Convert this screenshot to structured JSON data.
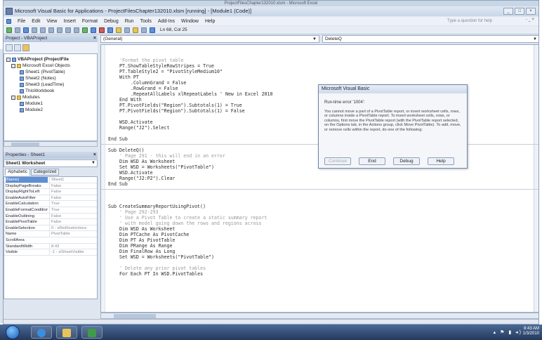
{
  "window": {
    "excel_title": "ProjectFilesChapter132010.xlsm - Microsoft Excel",
    "title": "Microsoft Visual Basic for Applications - ProjectFilesChapter132010.xlsm [running] - [Module1 (Code)]",
    "controls": [
      "_",
      "□",
      "×"
    ]
  },
  "menu": {
    "items": [
      "File",
      "Edit",
      "View",
      "Insert",
      "Format",
      "Debug",
      "Run",
      "Tools",
      "Add-Ins",
      "Window",
      "Help"
    ],
    "help_placeholder": "Type a question for help",
    "right": "- _ ×"
  },
  "toolbar": {
    "position": "Ln 68, Col 25"
  },
  "project_pane": {
    "title": "Project - VBAProject",
    "close": "×",
    "tree": [
      {
        "label": "VBAProject (ProjectFile",
        "bold": true,
        "level": 0
      },
      {
        "label": "Microsoft Excel Objects",
        "bold": false,
        "level": 1
      },
      {
        "label": "Sheet1 (PivotTable)",
        "bold": false,
        "level": 2
      },
      {
        "label": "Sheet2 (Notes)",
        "bold": false,
        "level": 2
      },
      {
        "label": "Sheet3 (LeadTime)",
        "bold": false,
        "level": 2
      },
      {
        "label": "ThisWorkbook",
        "bold": false,
        "level": 2
      },
      {
        "label": "Modules",
        "bold": false,
        "level": 1
      },
      {
        "label": "Module1",
        "bold": false,
        "level": 2
      },
      {
        "label": "Module2",
        "bold": false,
        "level": 2
      }
    ]
  },
  "properties_pane": {
    "title": "Properties - Sheet1",
    "close": "×",
    "object": "Sheet1 Worksheet",
    "tabs": [
      "Alphabetic",
      "Categorized"
    ],
    "rows": [
      {
        "name": "(Name)",
        "value": "Sheet1"
      },
      {
        "name": "DisplayPageBreaks",
        "value": "False"
      },
      {
        "name": "DisplayRightToLeft",
        "value": "False"
      },
      {
        "name": "EnableAutoFilter",
        "value": "False"
      },
      {
        "name": "EnableCalculation",
        "value": "True"
      },
      {
        "name": "EnableFormatConditions",
        "value": "True"
      },
      {
        "name": "EnableOutlining",
        "value": "False"
      },
      {
        "name": "EnablePivotTable",
        "value": "False"
      },
      {
        "name": "EnableSelection",
        "value": "0 - xlNoRestrictions"
      },
      {
        "name": "Name",
        "value": "PivotTable"
      },
      {
        "name": "ScrollArea",
        "value": ""
      },
      {
        "name": "StandardWidth",
        "value": "8.43"
      },
      {
        "name": "Visible",
        "value": "-1 - xlSheetVisible"
      }
    ]
  },
  "code": {
    "object_combo": "(General)",
    "proc_combo": "DeleteQ",
    "lines": [
      {
        "text": "'Format the pivot table",
        "comment": true,
        "indent": 4
      },
      {
        "text": "PT.ShowTableStyleRowStripes = True",
        "comment": false,
        "indent": 4
      },
      {
        "text": "PT.TableStyle2 = \"PivotStyleMedium10\"",
        "comment": false,
        "indent": 4
      },
      {
        "text": "With PT",
        "comment": false,
        "indent": 4
      },
      {
        "text": ".ColumnGrand = False",
        "comment": false,
        "indent": 8
      },
      {
        "text": ".RowGrand = False",
        "comment": false,
        "indent": 8
      },
      {
        "text": ".RepeatAllLabels xlRepeatLabels ' New in Excel 2010",
        "comment": false,
        "indent": 8
      },
      {
        "text": "End With",
        "comment": false,
        "indent": 4
      },
      {
        "text": "PT.PivotFields(\"Region\").Subtotals(1) = True",
        "comment": false,
        "indent": 4
      },
      {
        "text": "PT.PivotFields(\"Region\").Subtotals(1) = False",
        "comment": false,
        "indent": 4
      },
      {
        "text": "",
        "comment": false,
        "indent": 0
      },
      {
        "text": "WSD.Activate",
        "comment": false,
        "indent": 4
      },
      {
        "text": "Range(\"J2\").Select",
        "comment": false,
        "indent": 4
      },
      {
        "text": "",
        "comment": false,
        "indent": 0
      },
      {
        "text": "End Sub",
        "comment": false,
        "indent": 0
      },
      {
        "text": "",
        "comment": false,
        "indent": 0
      },
      {
        "text": "Sub DeleteQ()",
        "comment": false,
        "indent": 0
      },
      {
        "text": "' Page 291 - this will end in an error",
        "comment": true,
        "indent": 4
      },
      {
        "text": "Dim WSD As Worksheet",
        "comment": false,
        "indent": 4
      },
      {
        "text": "Set WSD = Worksheets(\"PivotTable\")",
        "comment": false,
        "indent": 4
      },
      {
        "text": "WSD.Activate",
        "comment": false,
        "indent": 4
      },
      {
        "text": "Range(\"J2:P2\").Clear",
        "comment": false,
        "indent": 4
      },
      {
        "text": "End Sub",
        "comment": false,
        "indent": 0
      },
      {
        "text": "",
        "comment": false,
        "indent": 0
      },
      {
        "text": "",
        "comment": false,
        "indent": 0
      },
      {
        "text": "",
        "comment": false,
        "indent": 0
      },
      {
        "text": "Sub CreateSummaryReportUsingPivot()",
        "comment": false,
        "indent": 0
      },
      {
        "text": "' Page 292-293",
        "comment": true,
        "indent": 4
      },
      {
        "text": "' Use a Pivot Table to create a static summary report",
        "comment": true,
        "indent": 4
      },
      {
        "text": "' with model going down the rows and regions across",
        "comment": true,
        "indent": 4
      },
      {
        "text": "Dim WSD As Worksheet",
        "comment": false,
        "indent": 4
      },
      {
        "text": "Dim PTCache As PivotCache",
        "comment": false,
        "indent": 4
      },
      {
        "text": "Dim PT As PivotTable",
        "comment": false,
        "indent": 4
      },
      {
        "text": "Dim PRange As Range",
        "comment": false,
        "indent": 4
      },
      {
        "text": "Dim FinalRow As Long",
        "comment": false,
        "indent": 4
      },
      {
        "text": "Set WSD = Worksheets(\"PivotTable\")",
        "comment": false,
        "indent": 4
      },
      {
        "text": "",
        "comment": false,
        "indent": 0
      },
      {
        "text": "' Delete any prior pivot tables",
        "comment": true,
        "indent": 4
      },
      {
        "text": "For Each PT In WSD.PivotTables",
        "comment": false,
        "indent": 4
      }
    ]
  },
  "dialog": {
    "title": "Microsoft Visual Basic",
    "error": "Run-time error '1004':",
    "message": "You cannot move a part of a PivotTable report, or insert worksheet cells, rows, or columns inside a PivotTable report. To insert worksheet cells, rows, or columns, first move the PivotTable report (with the PivotTable report selected, on the Options tab, in the Actions group, click Move PivotTable). To add, move, or remove cells within the report, do one of the following:",
    "buttons": [
      "Continue",
      "End",
      "Debug",
      "Help"
    ]
  },
  "taskbar": {
    "time": "8:43 AM",
    "date": "1/3/2010"
  }
}
